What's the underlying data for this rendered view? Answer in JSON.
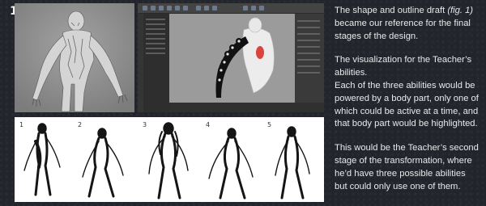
{
  "figure": {
    "number_label": "1"
  },
  "text_panel": {
    "para1_before": "The shape and outline draft ",
    "para1_ref": "(fig. 1)",
    "para1_after": " became our reference for the final stages of the design.",
    "para2_line1": "The visualization for the Teacher’s abilities.",
    "para2_line2": "Each of the three abilities would be powered by a body part, only one of which could be active at a time, and that body part would be highlighted.",
    "para3": "This would be the Teacher’s second stage of the transformation, where he’d have three possible abilities but could only use one of them."
  },
  "sketch_strip": {
    "pose_numbers": [
      "1",
      "2",
      "3",
      "4",
      "5"
    ]
  },
  "colors": {
    "background": "#22252c",
    "text": "#e9e9ea",
    "highlight": "#d9453a"
  }
}
